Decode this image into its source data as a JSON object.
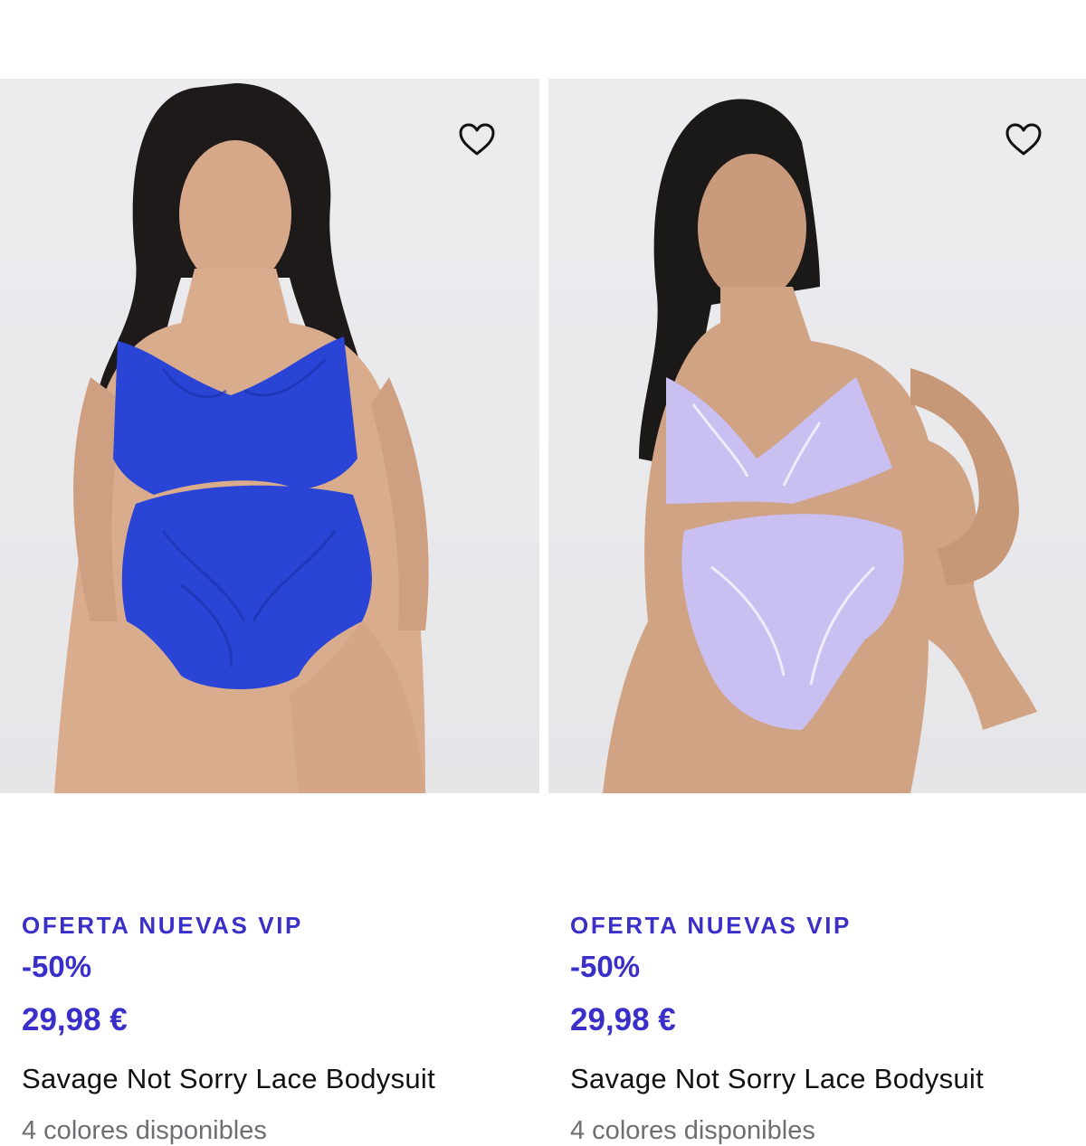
{
  "products": [
    {
      "promo_label": "OFERTA NUEVAS VIP",
      "discount": "-50%",
      "price": "29,98 €",
      "name": "Savage Not Sorry Lace Bodysuit",
      "colors_available": "4 colores disponibles",
      "product_color": "#2a45d6",
      "favorite_icon": "heart-outline-icon"
    },
    {
      "promo_label": "OFERTA NUEVAS VIP",
      "discount": "-50%",
      "price": "29,98 €",
      "name": "Savage Not Sorry Lace Bodysuit",
      "colors_available": "4 colores disponibles",
      "product_color": "#c9bff0",
      "favorite_icon": "heart-outline-icon"
    }
  ],
  "theme": {
    "accent": "#3a2fc9",
    "text": "#111111",
    "muted": "#6e6e73",
    "photo_background": "#eaeaed"
  }
}
